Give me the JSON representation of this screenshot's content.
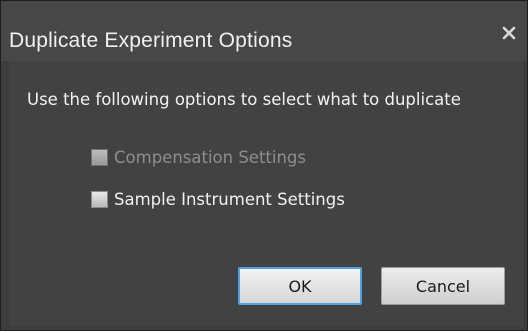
{
  "dialog": {
    "title": "Duplicate Experiment Options",
    "close_icon": "close-icon"
  },
  "instructions": "Use the following options to select what to duplicate",
  "options": [
    {
      "label": "Compensation Settings",
      "checked": false,
      "enabled": false
    },
    {
      "label": "Sample Instrument Settings",
      "checked": false,
      "enabled": true
    }
  ],
  "buttons": {
    "ok_label": "OK",
    "cancel_label": "Cancel"
  },
  "colors": {
    "dialog_background": "#3d3d3d",
    "titlebar_background": "#474747",
    "focus_border": "#4ea3e0"
  }
}
